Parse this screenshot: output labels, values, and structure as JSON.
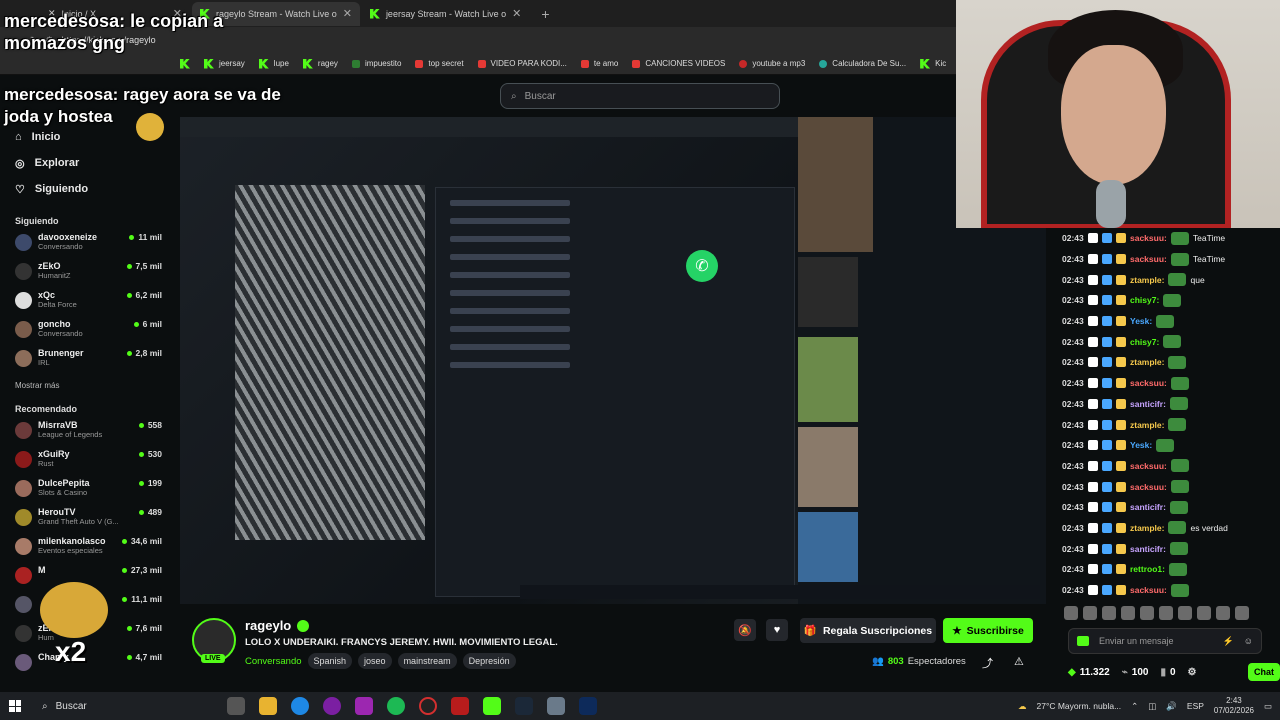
{
  "browser": {
    "tabs": [
      {
        "label": "Inicio / X",
        "active": false
      },
      {
        "label": "rageylo Stream - Watch Live o",
        "active": true
      },
      {
        "label": "jeersay Stream - Watch Live o",
        "active": false
      }
    ],
    "url": "https://kick.com/rageylo",
    "bookmarks": [
      "jeersay",
      "lupe",
      "ragey",
      "impuestito",
      "top secret",
      "VIDEO PARA KODI...",
      "te amo",
      "CANCIONES VIDEOS",
      "youtube a mp3",
      "Calculadora De Su...",
      "Kic"
    ]
  },
  "search": {
    "placeholder": "Buscar"
  },
  "sidebar": {
    "nav": [
      {
        "label": "Inicio",
        "icon": "home-icon"
      },
      {
        "label": "Explorar",
        "icon": "compass-icon"
      },
      {
        "label": "Siguiendo",
        "icon": "heart-icon"
      }
    ],
    "following_title": "Siguiendo",
    "following": [
      {
        "name": "davooxeneize",
        "category": "Conversando",
        "viewers": "11 mil"
      },
      {
        "name": "zEkO",
        "category": "HumanitZ",
        "viewers": "7,5 mil"
      },
      {
        "name": "xQc",
        "category": "Delta Force",
        "viewers": "6,2 mil"
      },
      {
        "name": "goncho",
        "category": "Conversando",
        "viewers": "6 mil"
      },
      {
        "name": "Brunenger",
        "category": "IRL",
        "viewers": "2,8 mil"
      }
    ],
    "show_more": "Mostrar más",
    "recommended_title": "Recomendado",
    "recommended": [
      {
        "name": "MisrraVB",
        "category": "League of Legends",
        "viewers": "558"
      },
      {
        "name": "xGuiRy",
        "category": "Rust",
        "viewers": "530"
      },
      {
        "name": "DulcePepita",
        "category": "Slots & Casino",
        "viewers": "199"
      },
      {
        "name": "HerouTV",
        "category": "Grand Theft Auto V (G...",
        "viewers": "489"
      },
      {
        "name": "milenkanolasco",
        "category": "Eventos especiales",
        "viewers": "34,6 mil"
      },
      {
        "name": "M",
        "category": "",
        "viewers": "27,3 mil"
      },
      {
        "name": "",
        "category": "",
        "viewers": "11,1 mil"
      },
      {
        "name": "zEk",
        "category": "Hum",
        "viewers": "7,6 mil"
      },
      {
        "name": "Chanty",
        "category": "",
        "viewers": "4,7 mil"
      }
    ]
  },
  "overlays": {
    "line1_user": "mercedesosa:",
    "line1_text": " le copian a",
    "line1b": "momazos gng",
    "line2_user": "mercedesosa:",
    "line2_text": " ragey aora se va de",
    "line2b": "joda y hostea",
    "x2": "x2"
  },
  "stream": {
    "streamer": "rageylo",
    "live_label": "LIVE",
    "title": "LOLO X UNDERAIKI. FRANCYS JEREMY. HWII. MOVIMIENTO LEGAL.",
    "category": "Conversando",
    "tags": [
      "Spanish",
      "joseo",
      "mainstream",
      "Depresión"
    ],
    "gift_label": "Regala Suscripciones",
    "subscribe_label": "Suscribirse",
    "viewers": "803",
    "viewers_label": "Espectadores"
  },
  "chat": {
    "messages": [
      {
        "time": "02:43",
        "user": "sacksuu:",
        "color": "#ff6b6b",
        "text": "TeaTime",
        "emote": true
      },
      {
        "time": "02:43",
        "user": "sacksuu:",
        "color": "#ff6b6b",
        "text": "TeaTime",
        "emote": true
      },
      {
        "time": "02:43",
        "user": "ztample:",
        "color": "#f5c84c",
        "text": "que",
        "emote": true
      },
      {
        "time": "02:43",
        "user": "chisy7:",
        "color": "#53fc18",
        "text": "",
        "emote": true
      },
      {
        "time": "02:43",
        "user": "Yesk:",
        "color": "#4aa8ff",
        "text": "",
        "emote": true
      },
      {
        "time": "02:43",
        "user": "chisy7:",
        "color": "#53fc18",
        "text": "",
        "emote": true
      },
      {
        "time": "02:43",
        "user": "ztample:",
        "color": "#f5c84c",
        "text": "",
        "emote": true
      },
      {
        "time": "02:43",
        "user": "sacksuu:",
        "color": "#ff6b6b",
        "text": "",
        "emote": true
      },
      {
        "time": "02:43",
        "user": "santicifr:",
        "color": "#c7a4ff",
        "text": "",
        "emote": true
      },
      {
        "time": "02:43",
        "user": "ztample:",
        "color": "#f5c84c",
        "text": "",
        "emote": true
      },
      {
        "time": "02:43",
        "user": "Yesk:",
        "color": "#4aa8ff",
        "text": "",
        "emote": true
      },
      {
        "time": "02:43",
        "user": "sacksuu:",
        "color": "#ff6b6b",
        "text": "",
        "emote": true
      },
      {
        "time": "02:43",
        "user": "sacksuu:",
        "color": "#ff6b6b",
        "text": "",
        "emote": true
      },
      {
        "time": "02:43",
        "user": "santicifr:",
        "color": "#c7a4ff",
        "text": "",
        "emote": true
      },
      {
        "time": "02:43",
        "user": "ztample:",
        "color": "#f5c84c",
        "text": "es verdad",
        "emote": true
      },
      {
        "time": "02:43",
        "user": "santicifr:",
        "color": "#c7a4ff",
        "text": "",
        "emote": true
      },
      {
        "time": "02:43",
        "user": "rettroo1:",
        "color": "#53fc18",
        "text": "",
        "emote": true
      },
      {
        "time": "02:43",
        "user": "sacksuu:",
        "color": "#ff6b6b",
        "text": "",
        "emote": true
      }
    ],
    "input_placeholder": "Enviar un mensaje",
    "points": "11.322",
    "ammo": "100",
    "sub_count": "0",
    "chat_button": "Chat"
  },
  "taskbar": {
    "search": "Buscar",
    "weather": "27°C  Mayorm. nubla...",
    "lang": "ESP",
    "time": "2:43",
    "date": "07/02/2026"
  }
}
